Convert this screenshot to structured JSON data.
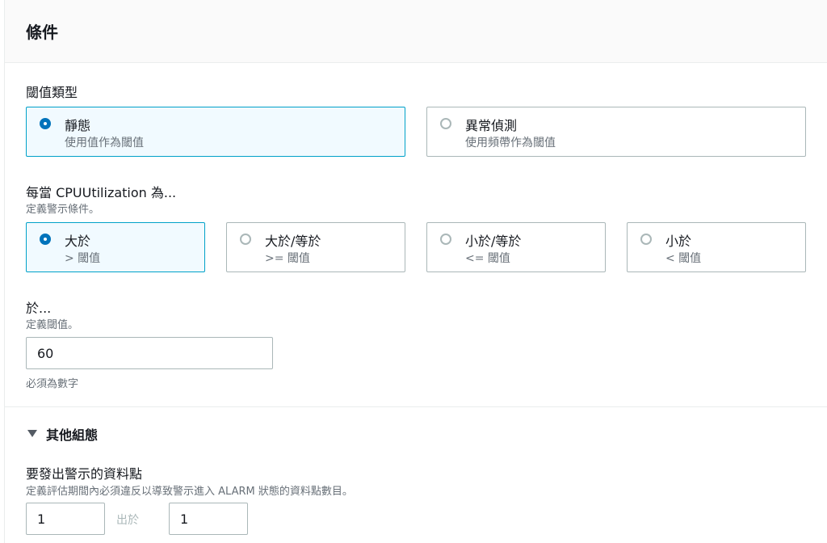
{
  "header": {
    "title": "條件"
  },
  "threshold_type": {
    "label": "閾值類型",
    "options": [
      {
        "title": "靜態",
        "subtitle": "使用值作為閾值",
        "selected": true
      },
      {
        "title": "異常偵測",
        "subtitle": "使用頻帶作為閾值",
        "selected": false
      }
    ]
  },
  "condition": {
    "label": "每當 CPUUtilization 為...",
    "description": "定義警示條件。",
    "options": [
      {
        "title": "大於",
        "subtitle": "> 閾值",
        "selected": true
      },
      {
        "title": "大於/等於",
        "subtitle": ">= 閾值",
        "selected": false
      },
      {
        "title": "小於/等於",
        "subtitle": "<= 閾值",
        "selected": false
      },
      {
        "title": "小於",
        "subtitle": "< 閾值",
        "selected": false
      }
    ]
  },
  "threshold_value": {
    "label": "於...",
    "description": "定義閾值。",
    "value": "60",
    "hint": "必須為數字"
  },
  "additional": {
    "toggle_label": "其他組態",
    "datapoints_label": "要發出警示的資料點",
    "datapoints_description": "定義評估期間內必須違反以導致警示進入 ALARM 狀態的資料點數目。",
    "datapoints_value": "1",
    "out_of": "出於",
    "period_value": "1"
  },
  "colors": {
    "accent": "#0073bb",
    "selected_border": "#00a1c9",
    "selected_bg": "#f1faff"
  }
}
